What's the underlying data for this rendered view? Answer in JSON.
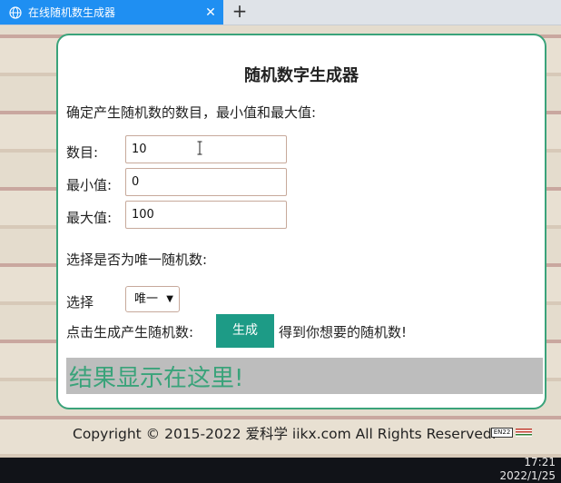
{
  "browser": {
    "tab_title": "在线随机数生成器",
    "close_glyph": "✕",
    "new_tab_glyph": "+"
  },
  "page": {
    "heading": "随机数字生成器",
    "intro": "确定产生随机数的数目，最小值和最大值:",
    "fields": [
      {
        "label": "数目:",
        "value": "10"
      },
      {
        "label": "最小值:",
        "value": "0"
      },
      {
        "label": "最大值:",
        "value": "100"
      }
    ],
    "unique_question": "选择是否为唯一随机数:",
    "select_label": "选择",
    "select_value": "唯一",
    "generate_prefix": "点击生成产生随机数:",
    "generate_button": "生成",
    "generate_suffix": "得到你想要的随机数!",
    "result_text": "结果显示在这里!",
    "copyright": "Copyright © 2015-2022 爱科学 iikx.com All Rights Reserved."
  },
  "footer_badge": "EN22",
  "taskbar": {
    "time": "17:21",
    "date": "2022/1/25"
  },
  "colors": {
    "tab_accent": "#1f8ff2",
    "card_border": "#3aa37a",
    "button_bg": "#1d9b86",
    "result_text": "#3aa37a"
  }
}
